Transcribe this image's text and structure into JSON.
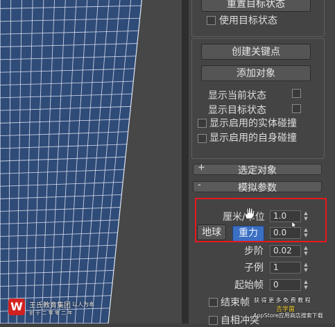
{
  "panel": {
    "reach_target_button": "重置目标状态",
    "use_target_state_label": "使用目标状态",
    "create_key_button": "创建关键点",
    "add_object_button": "添加对象",
    "show_current_state_label": "显示当前状态",
    "show_target_state_label": "显示目标状态",
    "show_enabled_solid_collision_label": "显示启用的实体碰撞",
    "show_enabled_self_collision_label": "显示启用的自身碰撞"
  },
  "rollouts": {
    "selected_object": {
      "sign": "+",
      "title": "选定对象"
    },
    "sim_params": {
      "sign": "-",
      "title": "模拟参数"
    }
  },
  "sim": {
    "cm_unit_label": "厘米/单位",
    "cm_unit_value": "1.0",
    "earth_button": "地球",
    "gravity_button": "重力",
    "gravity_value": "0.0",
    "step_label": "步阶",
    "step_value": "0.02",
    "subsample_label": "子例",
    "subsample_value": "1",
    "start_frame_label": "起始帧",
    "start_frame_value": "0",
    "end_frame_label": "结束帧",
    "self_collision_label": "自相冲突"
  },
  "watermark": {
    "logo_char": "W",
    "company": "王氏教育集团",
    "slogan_right": "以人为本",
    "subtitle": "创 于 二 零 零 二 年",
    "promo_line": "获 得 更 多 免 费 教 程",
    "brand": "吉学菌",
    "store_line": "AppStore应用商店搜索下载"
  },
  "colors": {
    "highlight": "#e8181e",
    "gravity_blue": "#3a6fc2",
    "mesh_fill": "#2f4b78",
    "mesh_lines": "#dfe6f3"
  }
}
